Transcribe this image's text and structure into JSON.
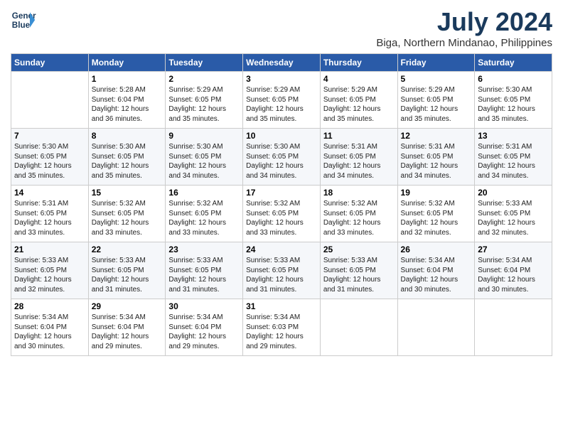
{
  "header": {
    "logo_line1": "General",
    "logo_line2": "Blue",
    "month_year": "July 2024",
    "location": "Biga, Northern Mindanao, Philippines"
  },
  "weekdays": [
    "Sunday",
    "Monday",
    "Tuesday",
    "Wednesday",
    "Thursday",
    "Friday",
    "Saturday"
  ],
  "weeks": [
    [
      {
        "day": "",
        "info": ""
      },
      {
        "day": "1",
        "info": "Sunrise: 5:28 AM\nSunset: 6:04 PM\nDaylight: 12 hours\nand 36 minutes."
      },
      {
        "day": "2",
        "info": "Sunrise: 5:29 AM\nSunset: 6:05 PM\nDaylight: 12 hours\nand 35 minutes."
      },
      {
        "day": "3",
        "info": "Sunrise: 5:29 AM\nSunset: 6:05 PM\nDaylight: 12 hours\nand 35 minutes."
      },
      {
        "day": "4",
        "info": "Sunrise: 5:29 AM\nSunset: 6:05 PM\nDaylight: 12 hours\nand 35 minutes."
      },
      {
        "day": "5",
        "info": "Sunrise: 5:29 AM\nSunset: 6:05 PM\nDaylight: 12 hours\nand 35 minutes."
      },
      {
        "day": "6",
        "info": "Sunrise: 5:30 AM\nSunset: 6:05 PM\nDaylight: 12 hours\nand 35 minutes."
      }
    ],
    [
      {
        "day": "7",
        "info": "Sunrise: 5:30 AM\nSunset: 6:05 PM\nDaylight: 12 hours\nand 35 minutes."
      },
      {
        "day": "8",
        "info": "Sunrise: 5:30 AM\nSunset: 6:05 PM\nDaylight: 12 hours\nand 35 minutes."
      },
      {
        "day": "9",
        "info": "Sunrise: 5:30 AM\nSunset: 6:05 PM\nDaylight: 12 hours\nand 34 minutes."
      },
      {
        "day": "10",
        "info": "Sunrise: 5:30 AM\nSunset: 6:05 PM\nDaylight: 12 hours\nand 34 minutes."
      },
      {
        "day": "11",
        "info": "Sunrise: 5:31 AM\nSunset: 6:05 PM\nDaylight: 12 hours\nand 34 minutes."
      },
      {
        "day": "12",
        "info": "Sunrise: 5:31 AM\nSunset: 6:05 PM\nDaylight: 12 hours\nand 34 minutes."
      },
      {
        "day": "13",
        "info": "Sunrise: 5:31 AM\nSunset: 6:05 PM\nDaylight: 12 hours\nand 34 minutes."
      }
    ],
    [
      {
        "day": "14",
        "info": "Sunrise: 5:31 AM\nSunset: 6:05 PM\nDaylight: 12 hours\nand 33 minutes."
      },
      {
        "day": "15",
        "info": "Sunrise: 5:32 AM\nSunset: 6:05 PM\nDaylight: 12 hours\nand 33 minutes."
      },
      {
        "day": "16",
        "info": "Sunrise: 5:32 AM\nSunset: 6:05 PM\nDaylight: 12 hours\nand 33 minutes."
      },
      {
        "day": "17",
        "info": "Sunrise: 5:32 AM\nSunset: 6:05 PM\nDaylight: 12 hours\nand 33 minutes."
      },
      {
        "day": "18",
        "info": "Sunrise: 5:32 AM\nSunset: 6:05 PM\nDaylight: 12 hours\nand 33 minutes."
      },
      {
        "day": "19",
        "info": "Sunrise: 5:32 AM\nSunset: 6:05 PM\nDaylight: 12 hours\nand 32 minutes."
      },
      {
        "day": "20",
        "info": "Sunrise: 5:33 AM\nSunset: 6:05 PM\nDaylight: 12 hours\nand 32 minutes."
      }
    ],
    [
      {
        "day": "21",
        "info": "Sunrise: 5:33 AM\nSunset: 6:05 PM\nDaylight: 12 hours\nand 32 minutes."
      },
      {
        "day": "22",
        "info": "Sunrise: 5:33 AM\nSunset: 6:05 PM\nDaylight: 12 hours\nand 31 minutes."
      },
      {
        "day": "23",
        "info": "Sunrise: 5:33 AM\nSunset: 6:05 PM\nDaylight: 12 hours\nand 31 minutes."
      },
      {
        "day": "24",
        "info": "Sunrise: 5:33 AM\nSunset: 6:05 PM\nDaylight: 12 hours\nand 31 minutes."
      },
      {
        "day": "25",
        "info": "Sunrise: 5:33 AM\nSunset: 6:05 PM\nDaylight: 12 hours\nand 31 minutes."
      },
      {
        "day": "26",
        "info": "Sunrise: 5:34 AM\nSunset: 6:04 PM\nDaylight: 12 hours\nand 30 minutes."
      },
      {
        "day": "27",
        "info": "Sunrise: 5:34 AM\nSunset: 6:04 PM\nDaylight: 12 hours\nand 30 minutes."
      }
    ],
    [
      {
        "day": "28",
        "info": "Sunrise: 5:34 AM\nSunset: 6:04 PM\nDaylight: 12 hours\nand 30 minutes."
      },
      {
        "day": "29",
        "info": "Sunrise: 5:34 AM\nSunset: 6:04 PM\nDaylight: 12 hours\nand 29 minutes."
      },
      {
        "day": "30",
        "info": "Sunrise: 5:34 AM\nSunset: 6:04 PM\nDaylight: 12 hours\nand 29 minutes."
      },
      {
        "day": "31",
        "info": "Sunrise: 5:34 AM\nSunset: 6:03 PM\nDaylight: 12 hours\nand 29 minutes."
      },
      {
        "day": "",
        "info": ""
      },
      {
        "day": "",
        "info": ""
      },
      {
        "day": "",
        "info": ""
      }
    ]
  ]
}
